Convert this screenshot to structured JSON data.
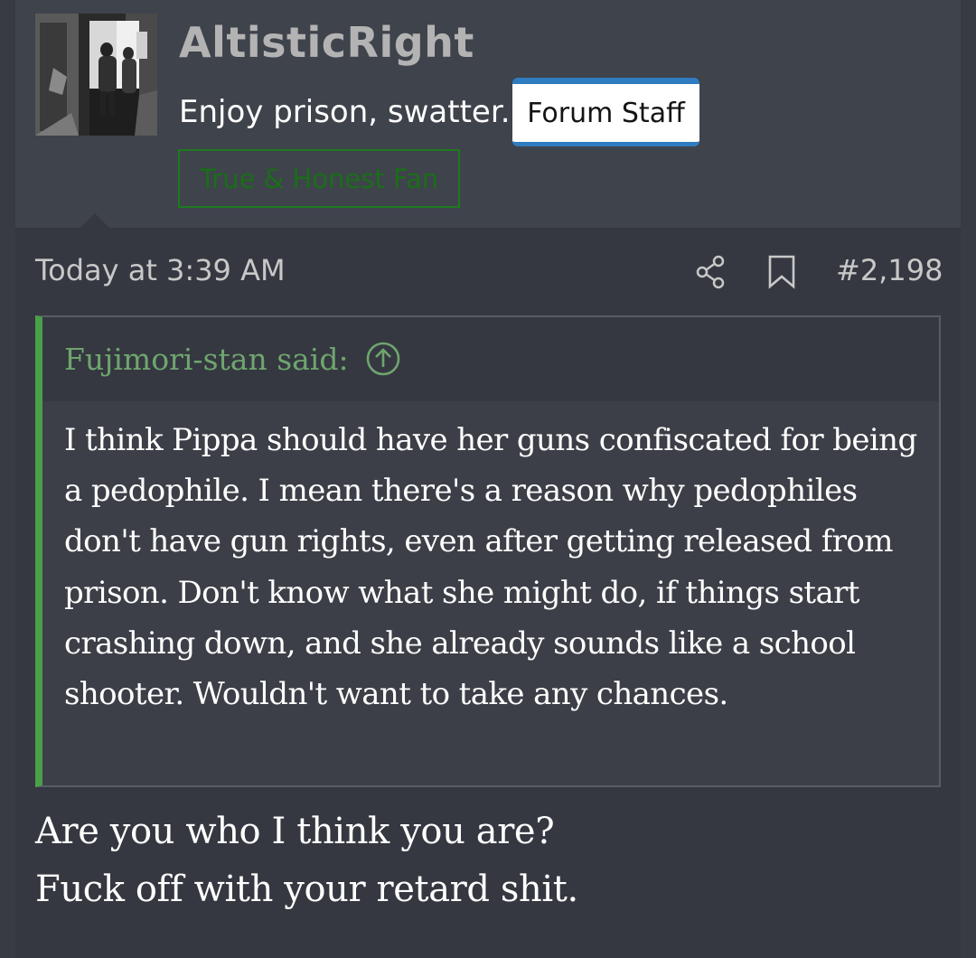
{
  "user": {
    "username": "AltisticRight",
    "title": "Enjoy prison, swatter.",
    "staff_badge": "Forum Staff",
    "fan_badge": "True & Honest Fan"
  },
  "post": {
    "timestamp": "Today at 3:39 AM",
    "number": "#2,198",
    "icons": [
      "share-icon",
      "bookmark-icon"
    ]
  },
  "quote": {
    "author": "Fujimori-stan said:",
    "body": "I think Pippa should have her guns confiscated for being a pedophile. I mean there's a reason why pedophiles don't have gun rights, even after getting released from prison. Don't know what she might do, if things start crashing down, and she already sounds like a school shooter. Wouldn't want to take any chances."
  },
  "reply": {
    "lines": [
      "Are you who I think you are?",
      "Fuck off with your retard shit."
    ]
  },
  "colors": {
    "background": "#383b43",
    "staff_accent": "#2f7cc0",
    "fan_badge": "#1d7a1d",
    "quote_bar": "#4aa04a",
    "quote_author": "#6fa56f"
  }
}
